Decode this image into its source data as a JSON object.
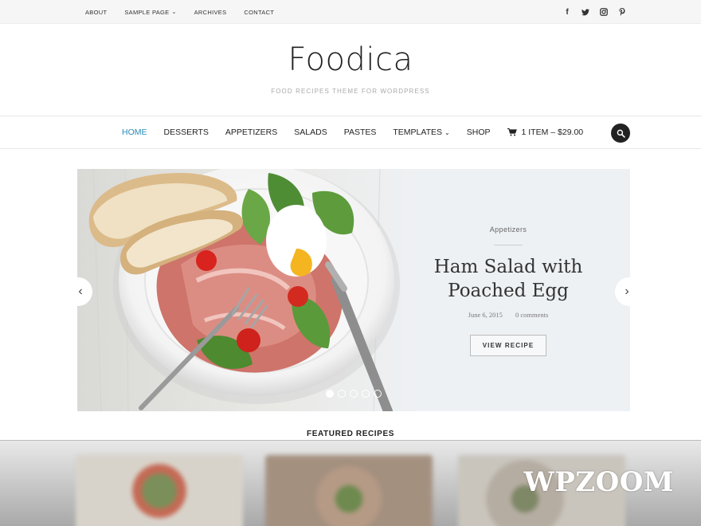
{
  "topbar": {
    "links": [
      {
        "label": "ABOUT"
      },
      {
        "label": "SAMPLE PAGE",
        "dropdown": true
      },
      {
        "label": "ARCHIVES"
      },
      {
        "label": "CONTACT"
      }
    ],
    "social": [
      {
        "glyph": "f",
        "icon": "facebook-icon"
      },
      {
        "glyph": "t",
        "icon": "twitter-icon"
      },
      {
        "glyph": "ig",
        "icon": "instagram-icon"
      },
      {
        "glyph": "p",
        "icon": "pinterest-icon"
      }
    ]
  },
  "brand": {
    "logo": "Foodica",
    "tagline": "FOOD RECIPES THEME FOR WORDPRESS"
  },
  "nav": {
    "items": [
      "HOME",
      "DESSERTS",
      "APPETIZERS",
      "SALADS",
      "PASTES",
      "TEMPLATES",
      "SHOP"
    ],
    "active": "HOME",
    "cart": "1 ITEM – $29.00",
    "accent": "#2a8ab8"
  },
  "slide": {
    "category": "Appetizers",
    "title_line1": "Ham Salad with",
    "title_line2": "Poached Egg",
    "date": "June 6, 2015",
    "comments": "0 comments",
    "button": "VIEW RECIPE",
    "current_slide": 1,
    "total_slides": 5
  },
  "featured": {
    "heading": "FEATURED RECIPES"
  },
  "watermark": "WPZOOM"
}
